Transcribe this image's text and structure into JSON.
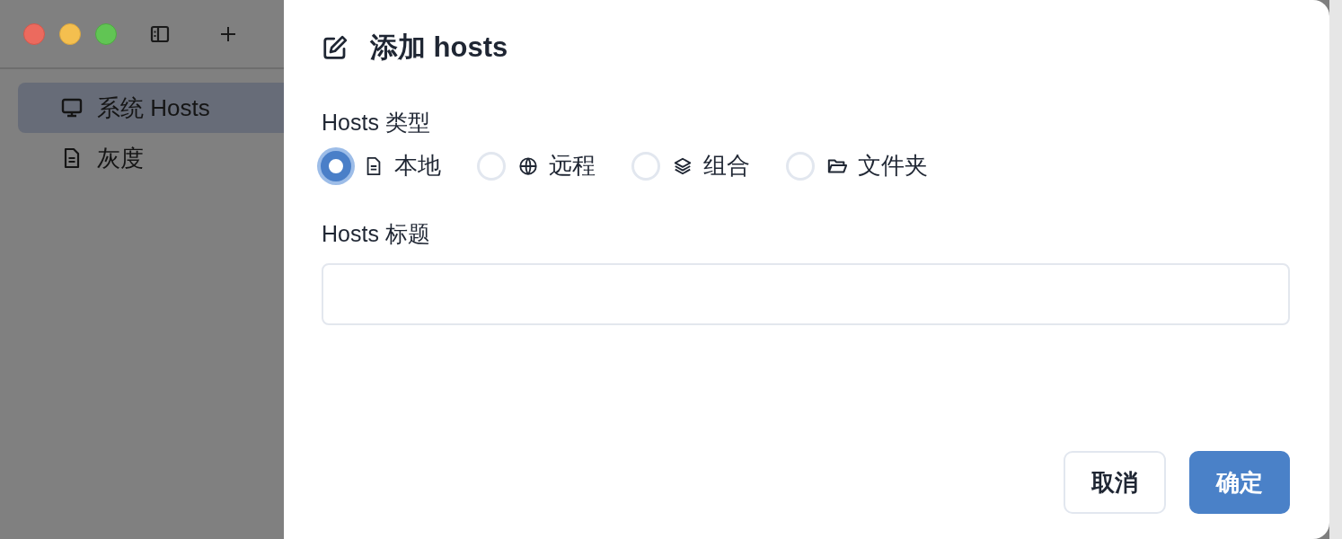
{
  "sidebar": {
    "items": [
      {
        "label": "系统 Hosts",
        "kind": "system",
        "selected": true
      },
      {
        "label": "灰度",
        "kind": "local",
        "selected": false
      }
    ]
  },
  "dialog": {
    "title": "添加 hosts",
    "type_field": {
      "label": "Hosts 类型",
      "options": [
        {
          "label": "本地",
          "kind": "local",
          "selected": true
        },
        {
          "label": "远程",
          "kind": "remote",
          "selected": false
        },
        {
          "label": "组合",
          "kind": "group",
          "selected": false
        },
        {
          "label": "文件夹",
          "kind": "folder",
          "selected": false
        }
      ]
    },
    "title_field": {
      "label": "Hosts 标题"
    },
    "buttons": [
      {
        "label": "取消",
        "kind": "secondary"
      },
      {
        "label": "确定",
        "kind": "primary"
      }
    ]
  }
}
